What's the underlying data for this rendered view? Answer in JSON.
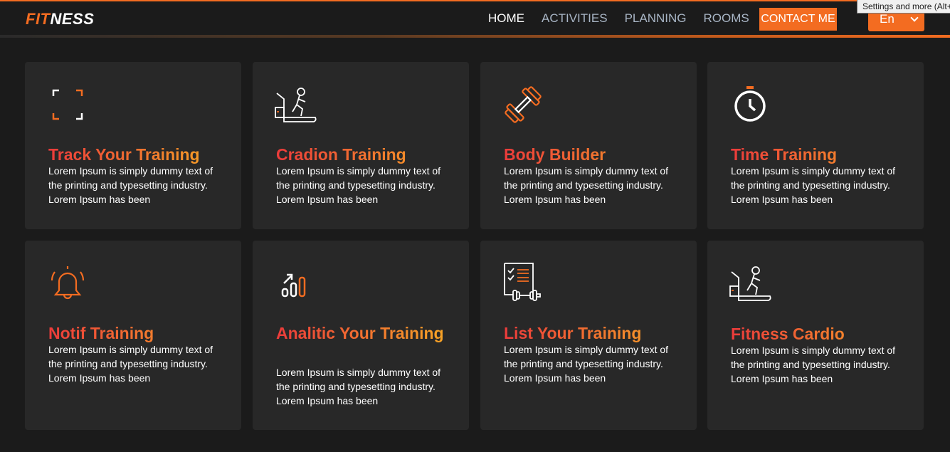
{
  "navbar": {
    "logo_part1": "FIT",
    "logo_part2": "NESS",
    "links": [
      "HOME",
      "ACTIVITIES",
      "PLANNING",
      "ROOMS"
    ],
    "contact_label": "CONTACT ME",
    "language": "En",
    "tooltip": "Settings and more (Alt+F)"
  },
  "colors": {
    "accent": "#f36c21",
    "background": "#1b1b1b",
    "card": "#282828",
    "title_gradient_start": "#ec3b3b",
    "title_gradient_end": "#f7a924"
  },
  "cards": [
    {
      "icon": "focus-frame-icon",
      "title": "Track Your Training",
      "text": "Lorem Ipsum is simply dummy text of the printing and typesetting industry. Lorem Ipsum has been"
    },
    {
      "icon": "treadmill-icon",
      "title": "Cradion Training",
      "text": "Lorem Ipsum is simply dummy text of the printing and typesetting industry. Lorem Ipsum has been"
    },
    {
      "icon": "dumbbell-icon",
      "title": "Body Builder",
      "text": "Lorem Ipsum is simply dummy text of the printing and typesetting industry. Lorem Ipsum has been"
    },
    {
      "icon": "stopwatch-icon",
      "title": "Time Training",
      "text": "Lorem Ipsum is simply dummy text of the printing and typesetting industry. Lorem Ipsum has been"
    },
    {
      "icon": "bell-icon",
      "title": "Notif Training",
      "text": "Lorem Ipsum is simply dummy text of the printing and typesetting industry. Lorem Ipsum has been"
    },
    {
      "icon": "analytics-icon",
      "title": "Analitic Your Training",
      "text": "Lorem Ipsum is simply dummy text of the printing and typesetting industry. Lorem Ipsum has been"
    },
    {
      "icon": "checklist-dumbbell-icon",
      "title": "List Your Training",
      "text": "Lorem Ipsum is simply dummy text of the printing and typesetting industry. Lorem Ipsum has been"
    },
    {
      "icon": "treadmill-icon",
      "title": "Fitness Cardio",
      "text": "Lorem Ipsum is simply dummy text of the printing and typesetting industry. Lorem Ipsum has been"
    }
  ]
}
